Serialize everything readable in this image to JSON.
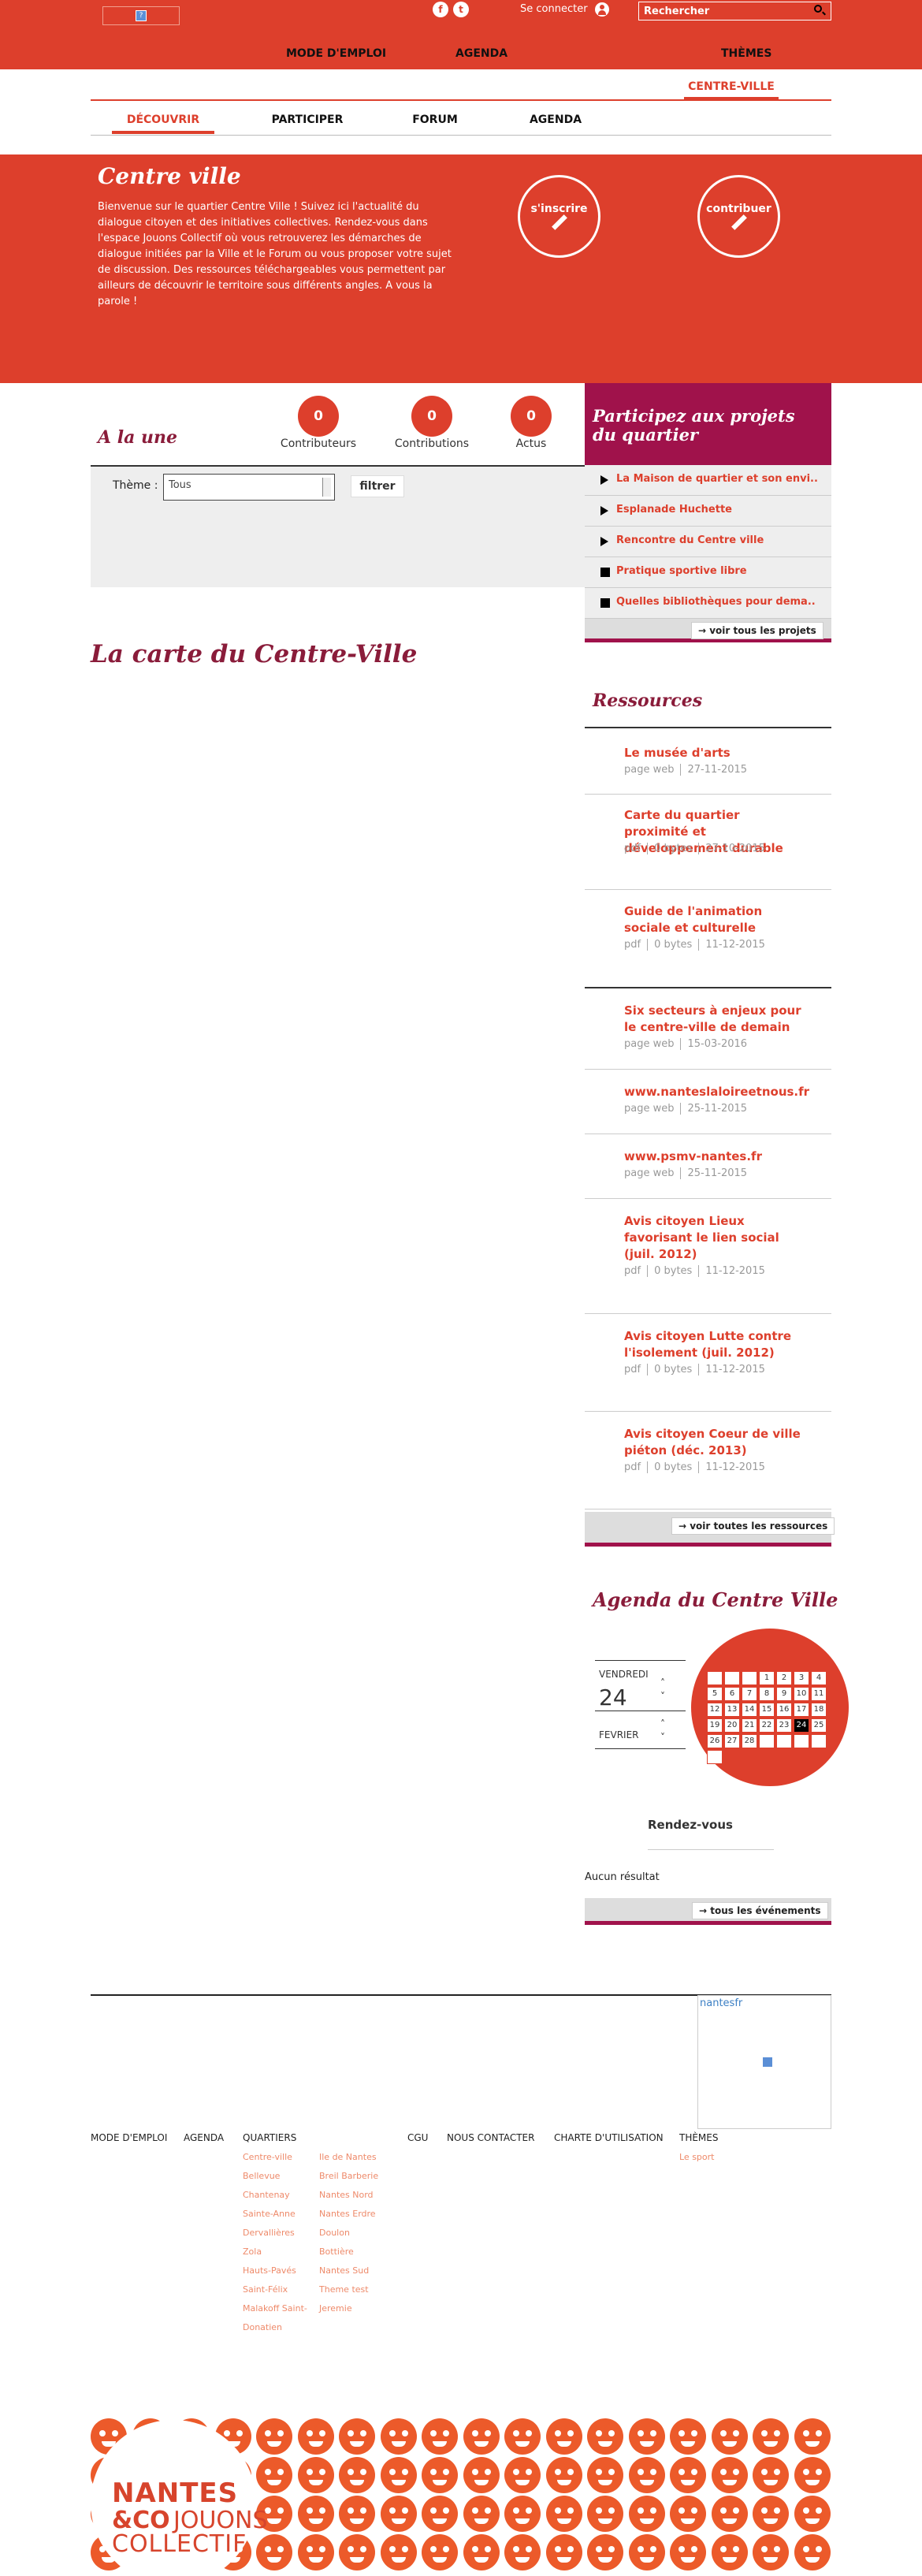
{
  "topbar": {
    "login": "Se connecter",
    "search_placeholder": "Rechercher",
    "social": [
      "f",
      "t"
    ]
  },
  "mainnav": [
    "MODE D'EMPLOI",
    "AGENDA",
    "THÈMES"
  ],
  "subnav_active": "CENTRE-VILLE",
  "quarter_tabs": [
    "DÉCOUVRIR",
    "PARTICIPER",
    "FORUM",
    "AGENDA"
  ],
  "hero": {
    "title": "Centre ville",
    "text": "Bienvenue sur le quartier Centre Ville ! Suivez ici l'actualité du dialogue citoyen et des initiatives collectives. Rendez-vous dans l'espace Jouons Collectif où vous retrouverez les démarches de dialogue initiées par la Ville et le Forum ou vous proposer votre sujet de discussion. Des ressources téléchargeables vous permettent par ailleurs de découvrir le territoire sous différents angles. A vous la parole !",
    "btn_inscrire": "s'inscrire",
    "btn_contribuer": "contribuer"
  },
  "stats": [
    {
      "value": "0",
      "label": "Contributeurs"
    },
    {
      "value": "0",
      "label": "Contributions"
    },
    {
      "value": "0",
      "label": "Actus"
    }
  ],
  "alaune": "A la une",
  "filter": {
    "label": "Thème :",
    "value": "Tous",
    "button": "filtrer"
  },
  "map_title": "La carte du Centre-Ville",
  "projects": {
    "title": "Participez aux projets du quartier",
    "items": [
      "La Maison de quartier et son envi..",
      "Esplanade Huchette",
      "Rencontre du Centre ville",
      "Pratique sportive libre",
      "Quelles bibliothèques pour dema.."
    ],
    "all": "voir tous les projets"
  },
  "resources": {
    "title": "Ressources",
    "items": [
      {
        "title": "Le musée d'arts",
        "type": "page web",
        "size": "",
        "date": "27-11-2015"
      },
      {
        "title": "Carte du quartier proximité et développement durable",
        "type": "pdf",
        "size": "0 bytes",
        "date": "27-10-2015"
      },
      {
        "title": "Guide de l'animation sociale et culturelle",
        "type": "pdf",
        "size": "0 bytes",
        "date": "11-12-2015"
      },
      {
        "title": "Six secteurs à enjeux pour le centre-ville de demain",
        "type": "page web",
        "size": "",
        "date": "15-03-2016"
      },
      {
        "title": "www.nanteslaloireetnous.fr",
        "type": "page web",
        "size": "",
        "date": "25-11-2015"
      },
      {
        "title": "www.psmv-nantes.fr",
        "type": "page web",
        "size": "",
        "date": "25-11-2015"
      },
      {
        "title": "Avis citoyen Lieux favorisant le lien social (juil. 2012)",
        "type": "pdf",
        "size": "0 bytes",
        "date": "11-12-2015"
      },
      {
        "title": "Avis citoyen Lutte contre l'isolement (juil. 2012)",
        "type": "pdf",
        "size": "0 bytes",
        "date": "11-12-2015"
      },
      {
        "title": "Avis citoyen Coeur de ville piéton (déc. 2013)",
        "type": "pdf",
        "size": "0 bytes",
        "date": "11-12-2015"
      }
    ],
    "all": "voir toutes les ressources"
  },
  "agenda": {
    "title": "Agenda du Centre Ville",
    "day_name": "VENDREDI",
    "day": "24",
    "month": "FEVRIER",
    "calendar": [
      "",
      "",
      "",
      "1",
      "2",
      "3",
      "4",
      "5",
      "6",
      "7",
      "8",
      "9",
      "10",
      "11",
      "12",
      "13",
      "14",
      "15",
      "16",
      "17",
      "18",
      "19",
      "20",
      "21",
      "22",
      "23",
      "24",
      "25",
      "26",
      "27",
      "28",
      "",
      "",
      "",
      "",
      ""
    ],
    "highlight": "24",
    "rdv": "Rendez-vous",
    "no_result": "Aucun résultat",
    "all": "tous les événements"
  },
  "footer": {
    "nantesfr": "nantesfr",
    "mode": "MODE D'EMPLOI",
    "agenda": "AGENDA",
    "quartiers": "QUARTIERS",
    "q1": [
      "Centre-ville",
      "Bellevue",
      "Chantenay",
      "Sainte-Anne",
      "Dervallières",
      "Zola",
      "Hauts-Pavés",
      "Saint-Félix",
      "Malakoff Saint-",
      "Donatien"
    ],
    "q2": [
      "Ile de Nantes",
      "Breil Barberie",
      "Nantes Nord",
      "Nantes Erdre",
      "Doulon",
      "Bottière",
      "Nantes Sud",
      "Theme test",
      "Jeremie"
    ],
    "cgu": "CGU",
    "contact": "NOUS CONTACTER",
    "charte": "CHARTE D'UTILISATION",
    "themes": "THÈMES",
    "themes_sub": "Le sport"
  },
  "logo": {
    "nantes": "NANTES",
    "co": "&CO",
    "jouons": "JOUONS",
    "collectif": "COLLECTIF"
  },
  "colors": {
    "brand": "#dd3f2c",
    "burgundy": "#8a1c3a"
  }
}
